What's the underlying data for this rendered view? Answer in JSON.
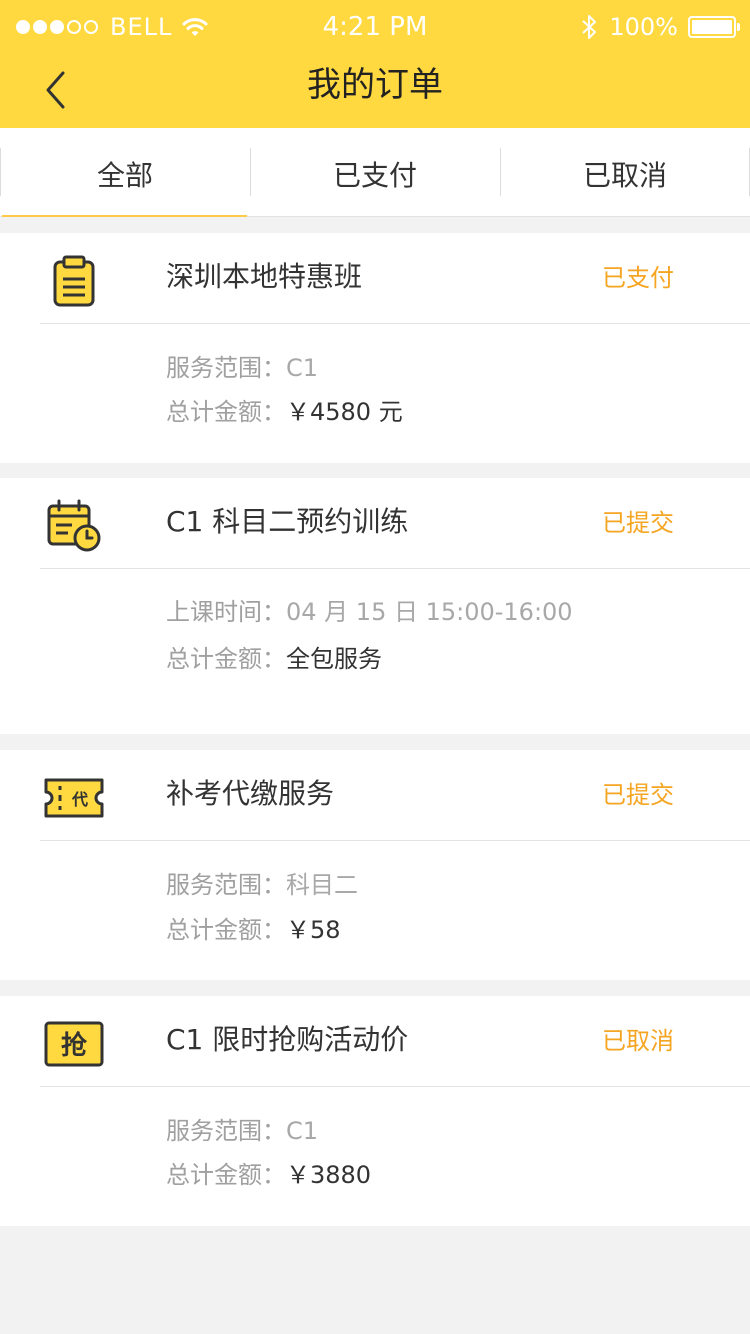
{
  "status_bar": {
    "carrier": "BELL",
    "time": "4:21 PM",
    "battery": "100%"
  },
  "nav": {
    "title": "我的订单"
  },
  "tabs": [
    {
      "label": "全部"
    },
    {
      "label": "已支付"
    },
    {
      "label": "已取消"
    }
  ],
  "orders": [
    {
      "icon": "clipboard-icon",
      "title": "深圳本地特惠班",
      "status": "已支付",
      "lines": [
        {
          "label": "服务范围：",
          "value": "C1"
        },
        {
          "label": "总计金额：",
          "value": "￥4580 元"
        }
      ]
    },
    {
      "icon": "calendar-clock-icon",
      "title": "C1 科目二预约训练",
      "status": "已提交",
      "lines": [
        {
          "label": "上课时间：",
          "value": "04 月 15 日  15:00-16:00"
        },
        {
          "label": "总计金额：",
          "value": "全包服务"
        }
      ]
    },
    {
      "icon": "ticket-icon",
      "icon_text": "代",
      "title": "补考代缴服务",
      "status": "已提交",
      "lines": [
        {
          "label": "服务范围：",
          "value": "科目二"
        },
        {
          "label": "总计金额：",
          "value": "￥58"
        }
      ]
    },
    {
      "icon": "flash-sale-icon",
      "icon_text": "抢",
      "title": "C1 限时抢购活动价",
      "status": "已取消",
      "lines": [
        {
          "label": "服务范围：",
          "value": "C1"
        },
        {
          "label": "总计金额：",
          "value": "￥3880"
        }
      ]
    }
  ],
  "colors": {
    "header": "#FFD93F",
    "status_text": "#F5A522",
    "icon_fill": "#FFD93F",
    "icon_stroke": "#333333"
  }
}
